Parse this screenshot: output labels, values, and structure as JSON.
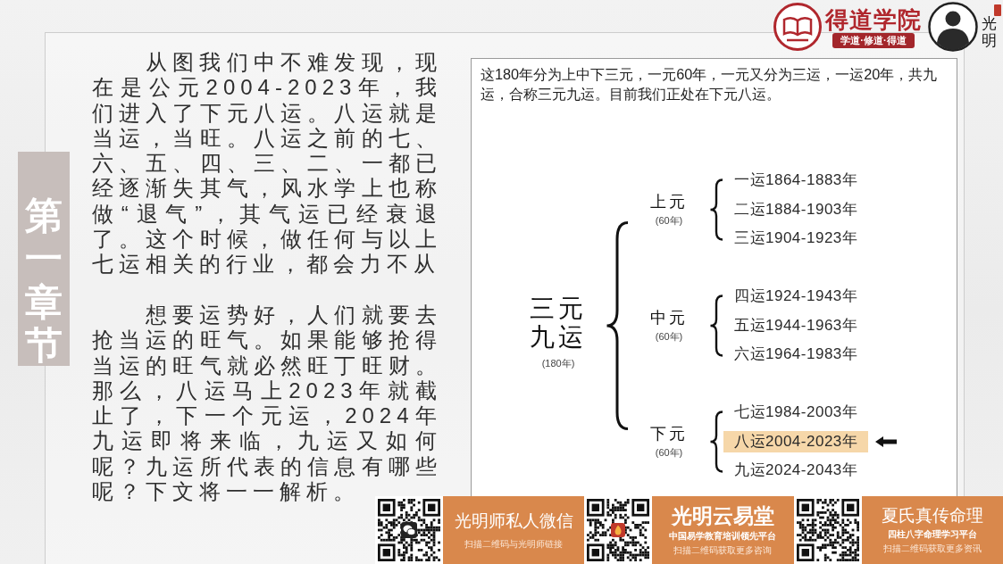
{
  "brand": {
    "name": "得道学院",
    "slogan": "学道·修道·得道",
    "teacher": "光明"
  },
  "chapter_label": "第一章节",
  "paragraphs": [
    "从图我们中不难发现，现在是公元2004-2023年，我们进入了下元八运。八运就是当运，当旺。八运之前的七、六、五、四、三、二、一都已经逐渐失其气，风水学上也称做“退气”，其气运已经衰退了。这个时候，做任何与以上七运相关的行业，都会力不从",
    "想要运势好，人们就要去抢当运的旺气。如果能够抢得当运的旺气就必然旺丁旺财。那么，八运马上2023年就截止了，下一个元运，2024年九运即将来临，九运又如何呢？九运所代表的信息有哪些呢？下文将一一解析。"
  ],
  "figure": {
    "caption": "这180年分为上中下三元，一元60年，一元又分为三运，一运20年，共九运，合称三元九运。目前我们正处在下元八运。",
    "root": {
      "title": "三元九运",
      "span": "(180年)"
    },
    "groups": [
      {
        "title": "上元",
        "span": "(60年)",
        "periods": [
          {
            "label": "一运1864-1883年",
            "highlighted": false
          },
          {
            "label": "二运1884-1903年",
            "highlighted": false
          },
          {
            "label": "三运1904-1923年",
            "highlighted": false
          }
        ]
      },
      {
        "title": "中元",
        "span": "(60年)",
        "periods": [
          {
            "label": "四运1924-1943年",
            "highlighted": false
          },
          {
            "label": "五运1944-1963年",
            "highlighted": false
          },
          {
            "label": "六运1964-1983年",
            "highlighted": false
          }
        ]
      },
      {
        "title": "下元",
        "span": "(60年)",
        "periods": [
          {
            "label": "七运1984-2003年",
            "highlighted": false
          },
          {
            "label": "八运2004-2023年",
            "highlighted": true
          },
          {
            "label": "九运2024-2043年",
            "highlighted": false
          }
        ]
      }
    ]
  },
  "promos": [
    {
      "kind": "contact",
      "title": "光明师私人微信",
      "note": "扫描二维码与光明师链接"
    },
    {
      "kind": "brand",
      "title": "光明云易堂",
      "tagline": "中国易学教育培训领先平台",
      "note": "扫描二维码获取更多咨询"
    },
    {
      "kind": "course",
      "title": "夏氏真传命理",
      "tagline": "四柱八字命理学习平台",
      "note": "扫描二维码获取更多资讯"
    }
  ]
}
